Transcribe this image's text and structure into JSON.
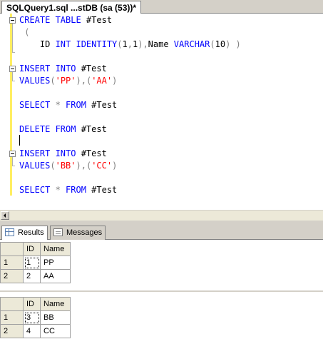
{
  "document_tab": {
    "title": "SQLQuery1.sql ...stDB (sa (53))*"
  },
  "editor": {
    "lines": [
      {
        "parts": [
          {
            "t": "CREATE TABLE ",
            "c": "kw"
          },
          {
            "t": "#Test",
            "c": ""
          }
        ]
      },
      {
        "parts": [
          {
            "t": " (",
            "c": "gray"
          }
        ]
      },
      {
        "parts": [
          {
            "t": "    ID ",
            "c": ""
          },
          {
            "t": "INT IDENTITY",
            "c": "kw"
          },
          {
            "t": "(",
            "c": "gray"
          },
          {
            "t": "1",
            "c": ""
          },
          {
            "t": ",",
            "c": "gray"
          },
          {
            "t": "1",
            "c": ""
          },
          {
            "t": "),",
            "c": "gray"
          },
          {
            "t": "Name ",
            "c": ""
          },
          {
            "t": "VARCHAR",
            "c": "kw"
          },
          {
            "t": "(",
            "c": "gray"
          },
          {
            "t": "10",
            "c": ""
          },
          {
            "t": ") )",
            "c": "gray"
          }
        ]
      },
      {
        "parts": []
      },
      {
        "parts": [
          {
            "t": "INSERT INTO ",
            "c": "kw"
          },
          {
            "t": "#Test",
            "c": ""
          }
        ]
      },
      {
        "parts": [
          {
            "t": "VALUES",
            "c": "kw"
          },
          {
            "t": "(",
            "c": "gray"
          },
          {
            "t": "'PP'",
            "c": "str"
          },
          {
            "t": "),(",
            "c": "gray"
          },
          {
            "t": "'AA'",
            "c": "str"
          },
          {
            "t": ")",
            "c": "gray"
          }
        ]
      },
      {
        "parts": []
      },
      {
        "parts": [
          {
            "t": "SELECT ",
            "c": "kw"
          },
          {
            "t": "* ",
            "c": "gray"
          },
          {
            "t": "FROM ",
            "c": "kw"
          },
          {
            "t": "#Test",
            "c": ""
          }
        ]
      },
      {
        "parts": []
      },
      {
        "parts": [
          {
            "t": "DELETE FROM ",
            "c": "kw"
          },
          {
            "t": "#Test",
            "c": ""
          }
        ]
      },
      {
        "parts": []
      },
      {
        "parts": [
          {
            "t": "INSERT INTO ",
            "c": "kw"
          },
          {
            "t": "#Test",
            "c": ""
          }
        ]
      },
      {
        "parts": [
          {
            "t": "VALUES",
            "c": "kw"
          },
          {
            "t": "(",
            "c": "gray"
          },
          {
            "t": "'BB'",
            "c": "str"
          },
          {
            "t": "),(",
            "c": "gray"
          },
          {
            "t": "'CC'",
            "c": "str"
          },
          {
            "t": ")",
            "c": "gray"
          }
        ]
      },
      {
        "parts": []
      },
      {
        "parts": [
          {
            "t": "SELECT ",
            "c": "kw"
          },
          {
            "t": "* ",
            "c": "gray"
          },
          {
            "t": "FROM ",
            "c": "kw"
          },
          {
            "t": "#Test",
            "c": ""
          }
        ]
      }
    ]
  },
  "result_tabs": [
    {
      "label": "Results",
      "icon": "grid-icon",
      "active": true
    },
    {
      "label": "Messages",
      "icon": "messages-icon",
      "active": false
    }
  ],
  "grids": [
    {
      "columns": [
        "ID",
        "Name"
      ],
      "rows": [
        {
          "num": "1",
          "id": "1",
          "name": "PP"
        },
        {
          "num": "2",
          "id": "2",
          "name": "AA"
        }
      ]
    },
    {
      "columns": [
        "ID",
        "Name"
      ],
      "rows": [
        {
          "num": "1",
          "id": "3",
          "name": "BB"
        },
        {
          "num": "2",
          "id": "4",
          "name": "CC"
        }
      ]
    }
  ],
  "colors": {
    "keyword": "#0000ff",
    "string": "#ff0000",
    "operator": "#808080",
    "change_bar": "#ffee62"
  }
}
